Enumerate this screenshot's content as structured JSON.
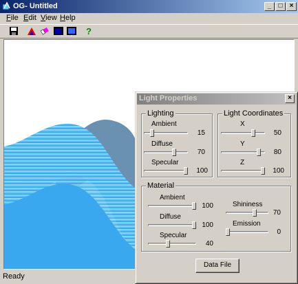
{
  "window": {
    "title": "OG- Untitled",
    "caption_buttons": {
      "minimize": "_",
      "maximize": "□",
      "close": "×"
    }
  },
  "menu": {
    "items": [
      {
        "label": "File",
        "underline": "F",
        "rest": "ile"
      },
      {
        "label": "Edit",
        "underline": "E",
        "rest": "dit"
      },
      {
        "label": "View",
        "underline": "V",
        "rest": "iew"
      },
      {
        "label": "Help",
        "underline": "H",
        "rest": "elp"
      }
    ]
  },
  "toolbar": {
    "icons": [
      "save-icon",
      "color-icon",
      "eraser-icon",
      "view-icon",
      "window-icon",
      "help-icon"
    ]
  },
  "status": {
    "text": "Ready"
  },
  "dialog": {
    "title": "Light Properties",
    "close_label": "×",
    "lighting": {
      "label": "Lighting",
      "ambient": {
        "label": "Ambient",
        "value": "15",
        "level": 0.15
      },
      "diffuse": {
        "label": "Diffuse",
        "value": "70",
        "level": 0.7
      },
      "specular": {
        "label": "Specular",
        "value": "100",
        "level": 1.0
      }
    },
    "coords": {
      "label": "Light Coordinates",
      "x": {
        "label": "X",
        "value": "50",
        "level": 0.75
      },
      "y": {
        "label": "Y",
        "value": "80",
        "level": 0.9
      },
      "z": {
        "label": "Z",
        "value": "100",
        "level": 1.0
      }
    },
    "material": {
      "label": "Material",
      "ambient": {
        "label": "Ambient",
        "value": "100",
        "level": 1.0
      },
      "diffuse": {
        "label": "Diffuse",
        "value": "100",
        "level": 1.0
      },
      "specular": {
        "label": "Specular",
        "value": "40",
        "level": 0.4
      },
      "shininess": {
        "label": "Shininess",
        "value": "70",
        "level": 0.7
      },
      "emission": {
        "label": "Emission",
        "value": "0",
        "level": 0.0
      }
    },
    "data_file_button": "Data File"
  },
  "colors": {
    "title_active": "#0a246a",
    "surface": "#6cc8ff",
    "face": "#d4d0c8"
  }
}
